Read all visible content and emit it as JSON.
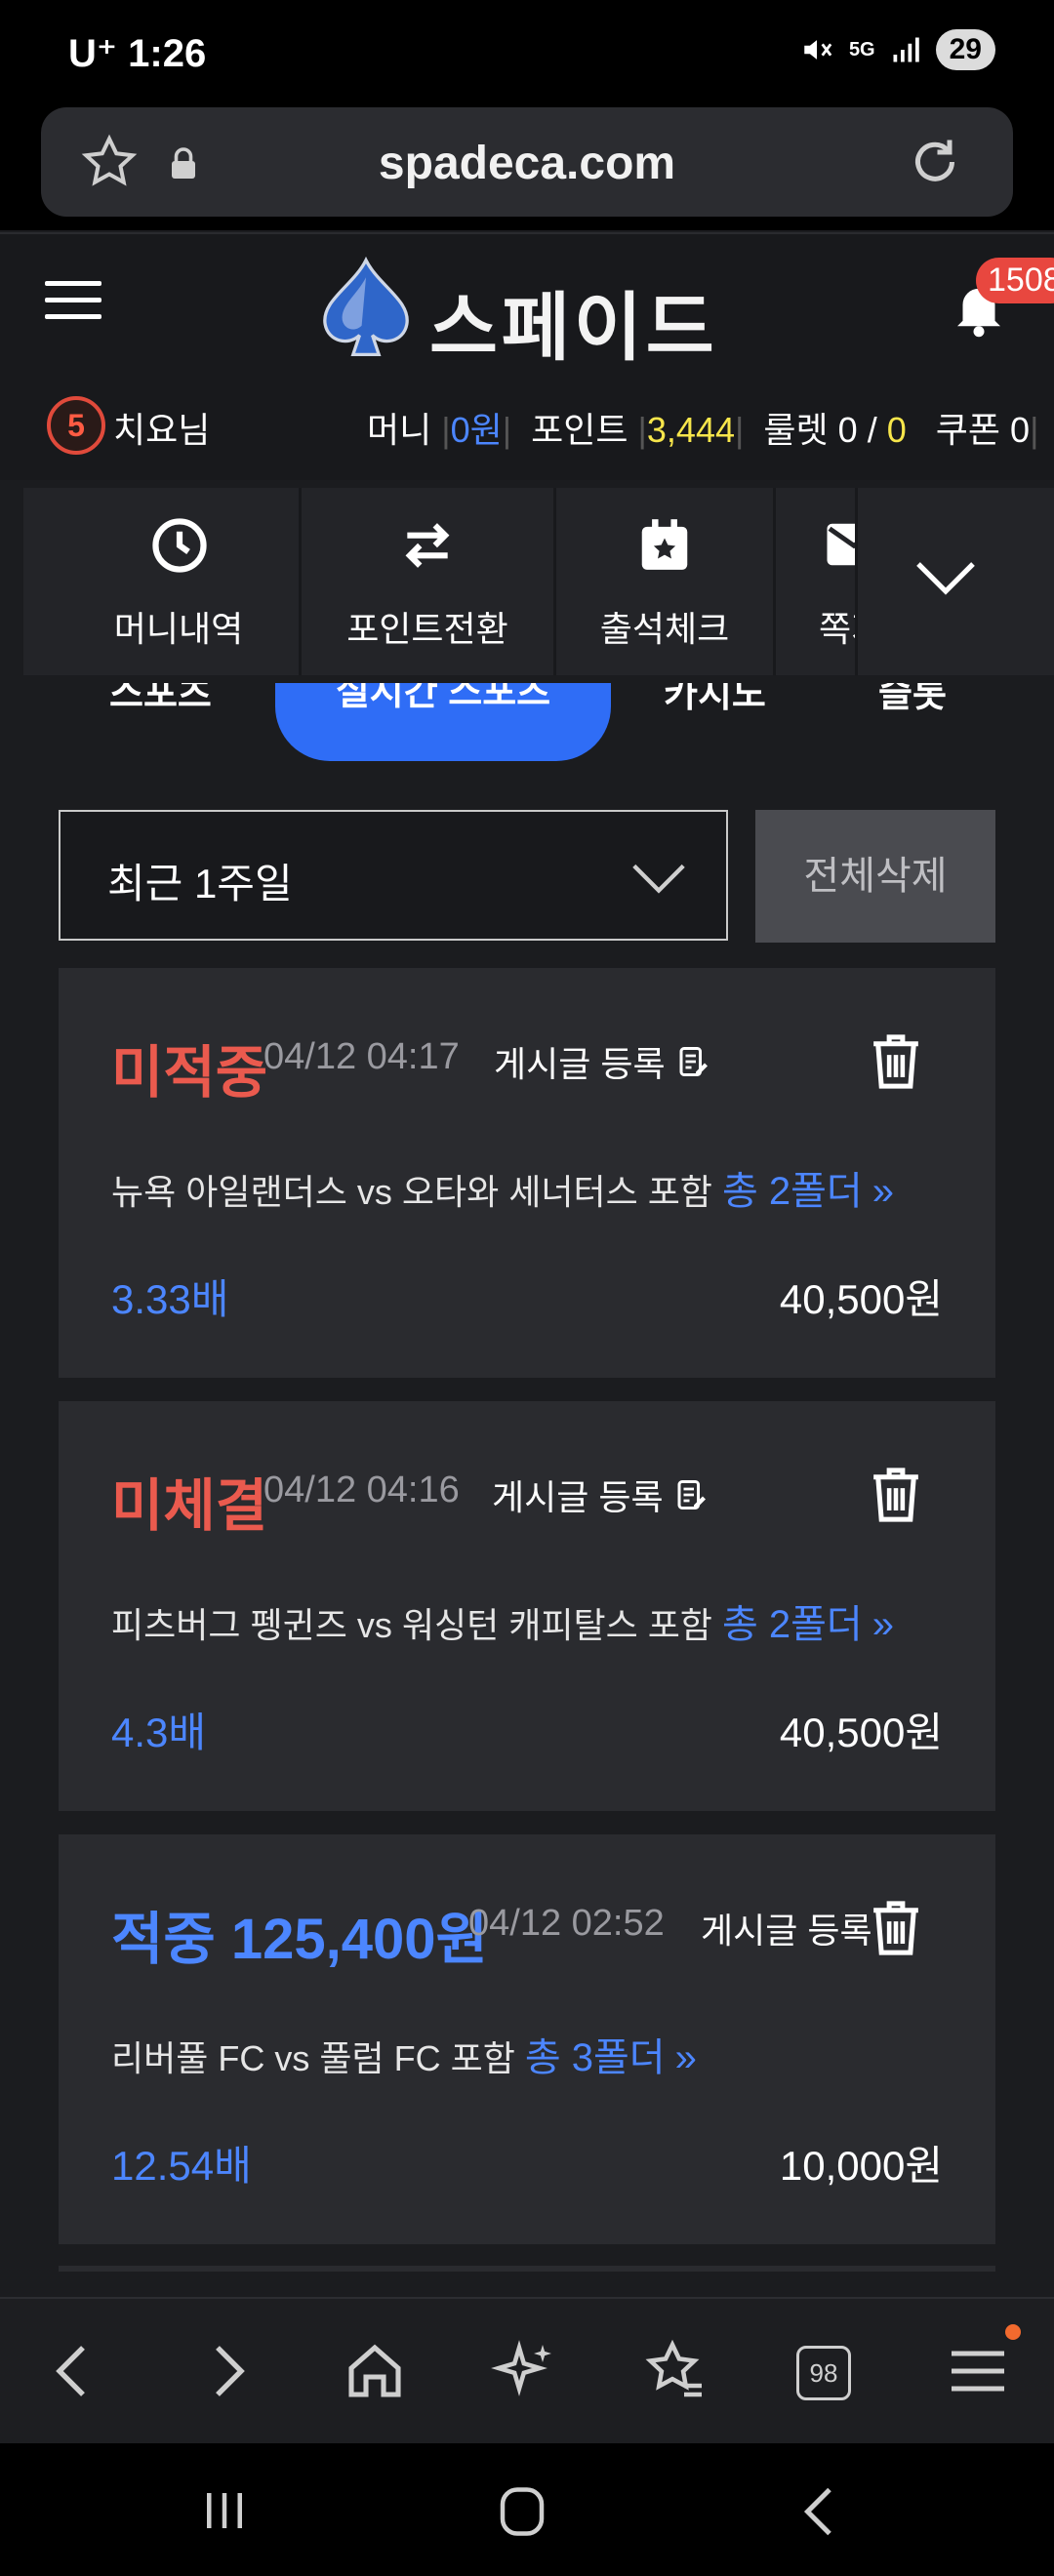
{
  "status_bar": {
    "carrier": "U⁺",
    "time": "1:26",
    "network": "5G",
    "battery": "29"
  },
  "browser": {
    "url": "spadeca.com"
  },
  "header": {
    "logo_text": "스페이드",
    "notification_count": "1508"
  },
  "user": {
    "level": "5",
    "name": "치요님",
    "money_label": "머니",
    "money_value": "0원",
    "point_label": "포인트",
    "point_value": "3,444",
    "roulette_label": "룰렛",
    "roulette_value": "0",
    "roulette_sep": "/",
    "roulette_total": "0",
    "coupon_label": "쿠폰",
    "coupon_value": "0"
  },
  "quick_menu": [
    {
      "label": "머니내역",
      "icon": "clock-icon"
    },
    {
      "label": "포인트전환",
      "icon": "swap-arrows-icon"
    },
    {
      "label": "출석체크",
      "icon": "calendar-star-icon"
    },
    {
      "label": "쪽지",
      "icon": "mail-icon"
    }
  ],
  "tabs": [
    {
      "label": "스포츠"
    },
    {
      "label": "실시간 스포츠",
      "active": true
    },
    {
      "label": "카지노"
    },
    {
      "label": "슬롯"
    }
  ],
  "filter": {
    "period": "최근 1주일",
    "delete_all": "전체삭제"
  },
  "bets": [
    {
      "status": "미적중",
      "status_color": "#ea5a4e",
      "datetime": "04/12 04:17",
      "post_label": "게시글 등록",
      "match": "뉴욕 아일랜더스 vs 오타와 세너터스 포함",
      "folder": "총 2폴더",
      "odds": "3.33배",
      "amount": "40,500원"
    },
    {
      "status": "미체결",
      "status_color": "#ea5a4e",
      "datetime": "04/12 04:16",
      "post_label": "게시글 등록",
      "match": "피츠버그 펭귄즈 vs 워싱턴 캐피탈스 포함",
      "folder": "총 2폴더",
      "odds": "4.3배",
      "amount": "40,500원"
    },
    {
      "status": "적중 125,400원",
      "status_color": "#4c86ff",
      "datetime": "04/12 02:52",
      "post_label": "게시글 등록",
      "match": "리버풀 FC vs 풀럼 FC 포함",
      "folder": "총 3폴더",
      "odds": "12.54배",
      "amount": "10,000원"
    }
  ],
  "bottom_nav": {
    "tab_count": "98"
  },
  "colors": {
    "accent": "#2f6df6",
    "loss": "#ea5a4e",
    "win": "#4c86ff",
    "point": "#f7e64b"
  }
}
